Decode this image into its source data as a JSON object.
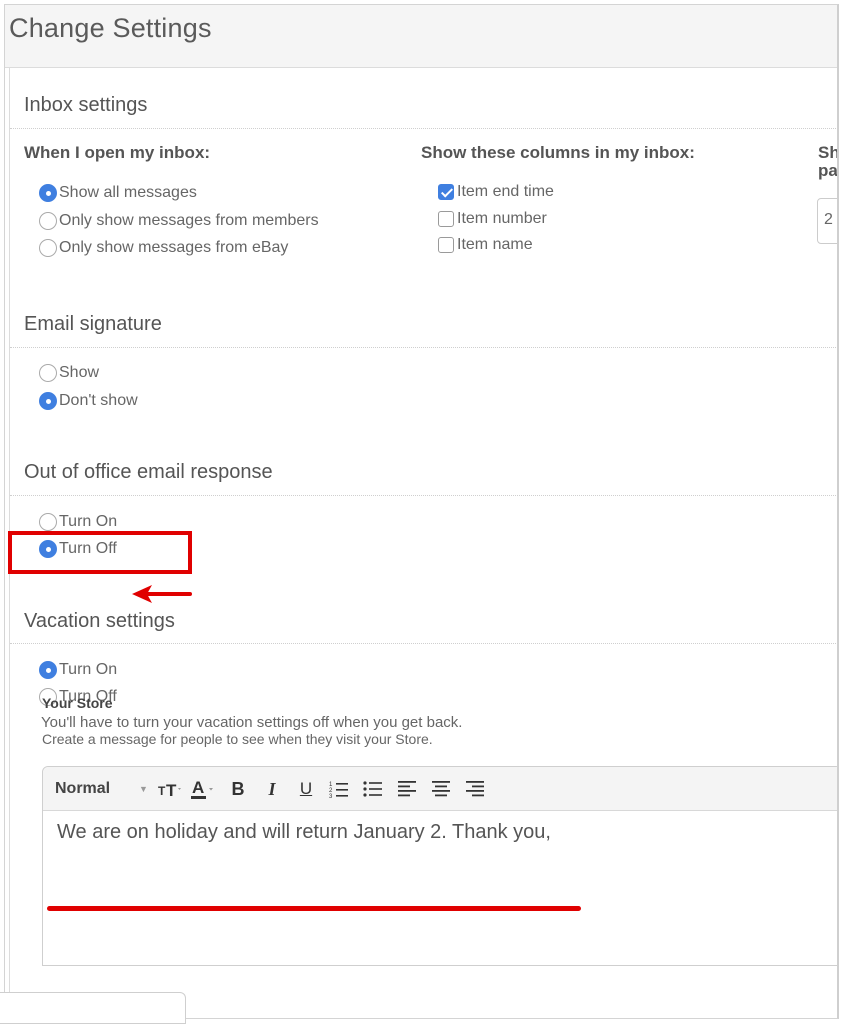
{
  "page": {
    "title": "Change Settings"
  },
  "inbox": {
    "title": "Inbox settings",
    "open_heading": "When I open my inbox:",
    "open_options": [
      "Show all messages",
      "Only show messages from members",
      "Only show messages from eBay"
    ],
    "open_selected": "Show all messages",
    "columns_heading": "Show these columns in my inbox:",
    "column_options": [
      {
        "label": "Item end time",
        "checked": true
      },
      {
        "label": "Item number",
        "checked": false
      },
      {
        "label": "Item name",
        "checked": false
      }
    ],
    "per_page_heading_line1": "Sh",
    "per_page_heading_line2": "pa",
    "per_page_value": "2"
  },
  "signature": {
    "title": "Email signature",
    "options": [
      "Show",
      "Don't show"
    ],
    "selected": "Don't show"
  },
  "out_of_office": {
    "title": "Out of office email response",
    "options": [
      "Turn On",
      "Turn Off"
    ],
    "selected": "Turn Off"
  },
  "vacation": {
    "title": "Vacation settings",
    "options": [
      "Turn On",
      "Turn Off"
    ],
    "selected": "Turn On",
    "note": "You'll have to turn your vacation settings off when you get back.",
    "store_heading": "Your Store",
    "store_description": "Create a message for people to see when they visit your Store.",
    "editor": {
      "format_value": "Normal",
      "text": "We are on holiday and will return January 2. Thank you,"
    }
  },
  "colors": {
    "accent": "#3f7fe0",
    "annotation": "#e00000"
  }
}
